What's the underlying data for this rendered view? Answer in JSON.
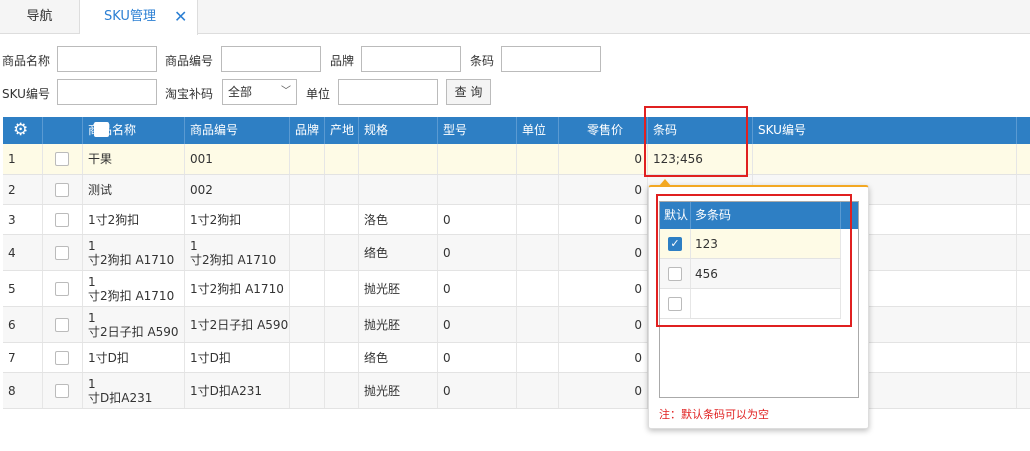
{
  "tabs": {
    "nav": "导航",
    "sku": "SKU管理",
    "close": "✕"
  },
  "filters": {
    "product_name": "商品名称",
    "product_code": "商品编号",
    "brand": "品牌",
    "barcode": "条码",
    "sku_code": "SKU编号",
    "taobao": "淘宝补码",
    "taobao_value": "全部",
    "unit": "单位",
    "query": "查 询"
  },
  "grid": {
    "headers": [
      "商品名称",
      "商品编号",
      "品牌",
      "产地",
      "规格",
      "型号",
      "单位",
      "零售价",
      "条码",
      "SKU编号"
    ],
    "rows": [
      {
        "n": "1",
        "name": "干果",
        "code": "001",
        "spec": "",
        "model": "",
        "price": "0",
        "barcode": "123;456"
      },
      {
        "n": "2",
        "name": "测试",
        "code": "002",
        "spec": "",
        "model": "",
        "price": "0",
        "barcode": ""
      },
      {
        "n": "3",
        "name": "1寸2狗扣",
        "code": "1寸2狗扣",
        "spec": "洛色",
        "model": "0",
        "price": "0",
        "barcode": ""
      },
      {
        "n": "4",
        "name": "1\n寸2狗扣  A1710",
        "code": "1\n寸2狗扣  A1710",
        "spec": "络色",
        "model": "0",
        "price": "0",
        "barcode": ""
      },
      {
        "n": "5",
        "name": "1\n寸2狗扣  A1710",
        "code": "1寸2狗扣  A1710",
        "spec": "抛光胚",
        "model": "0",
        "price": "0",
        "barcode": ""
      },
      {
        "n": "6",
        "name": "1\n寸2日子扣 A590",
        "code": "1寸2日子扣 A590",
        "spec": "抛光胚",
        "model": "0",
        "price": "0",
        "barcode": ""
      },
      {
        "n": "7",
        "name": "1寸D扣",
        "code": "1寸D扣",
        "spec": "络色",
        "model": "0",
        "price": "0",
        "barcode": ""
      },
      {
        "n": "8",
        "name": "1\n寸D扣A231",
        "code": "1寸D扣A231",
        "spec": "抛光胚",
        "model": "0",
        "price": "0",
        "barcode": ""
      }
    ]
  },
  "popup": {
    "headers": [
      "默认",
      "多条码"
    ],
    "rows": [
      {
        "checked": true,
        "value": "123"
      },
      {
        "checked": false,
        "value": "456"
      },
      {
        "checked": false,
        "value": ""
      }
    ],
    "note": "注：默认条码可以为空"
  },
  "colors": {
    "header": "#2e7fc4",
    "accent": "#f3a823",
    "highlight": "#e02020"
  }
}
